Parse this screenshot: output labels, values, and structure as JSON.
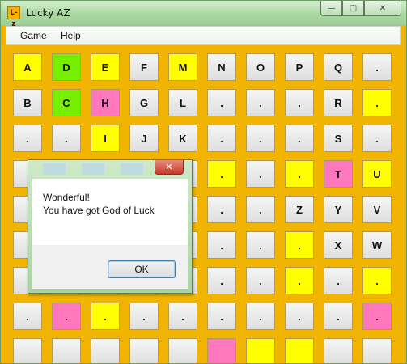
{
  "window": {
    "title": "Lucky AZ",
    "icon": "lucky-az-app-icon",
    "icon_text": "L-z",
    "controls": {
      "minimize": "minimize-icon",
      "maximize": "maximize-icon",
      "close": "close-icon"
    }
  },
  "menu": [
    {
      "label": "Game"
    },
    {
      "label": "Help"
    }
  ],
  "colors": {
    "board": "#f1b400",
    "yellow": "#ffff00",
    "green": "#77ef00",
    "pink": "#ff78bd",
    "gray": "#e6e6e6"
  },
  "board": {
    "rows": [
      [
        {
          "t": "A",
          "c": "yellow"
        },
        {
          "t": "D",
          "c": "green"
        },
        {
          "t": "E",
          "c": "yellow"
        },
        {
          "t": "F",
          "c": "gray"
        },
        {
          "t": "M",
          "c": "yellow"
        },
        {
          "t": "N",
          "c": "gray"
        },
        {
          "t": "O",
          "c": "gray"
        },
        {
          "t": "P",
          "c": "gray"
        },
        {
          "t": "Q",
          "c": "gray"
        },
        {
          "t": ".",
          "c": "gray"
        }
      ],
      [
        {
          "t": "B",
          "c": "gray"
        },
        {
          "t": "C",
          "c": "green"
        },
        {
          "t": "H",
          "c": "pink"
        },
        {
          "t": "G",
          "c": "gray"
        },
        {
          "t": "L",
          "c": "gray"
        },
        {
          "t": ".",
          "c": "gray"
        },
        {
          "t": ".",
          "c": "gray"
        },
        {
          "t": ".",
          "c": "gray"
        },
        {
          "t": "R",
          "c": "gray"
        },
        {
          "t": ".",
          "c": "yellow"
        }
      ],
      [
        {
          "t": ".",
          "c": "gray"
        },
        {
          "t": ".",
          "c": "gray"
        },
        {
          "t": "I",
          "c": "yellow"
        },
        {
          "t": "J",
          "c": "gray"
        },
        {
          "t": "K",
          "c": "gray"
        },
        {
          "t": ".",
          "c": "gray"
        },
        {
          "t": ".",
          "c": "gray"
        },
        {
          "t": ".",
          "c": "gray"
        },
        {
          "t": "S",
          "c": "gray"
        },
        {
          "t": ".",
          "c": "gray"
        }
      ],
      [
        {
          "t": "",
          "c": "gray"
        },
        {
          "t": "",
          "c": "gray"
        },
        {
          "t": "",
          "c": "gray"
        },
        {
          "t": "",
          "c": "gray"
        },
        {
          "t": "",
          "c": "gray"
        },
        {
          "t": ".",
          "c": "yellow"
        },
        {
          "t": ".",
          "c": "gray"
        },
        {
          "t": ".",
          "c": "yellow"
        },
        {
          "t": "T",
          "c": "pink"
        },
        {
          "t": "U",
          "c": "yellow"
        }
      ],
      [
        {
          "t": "",
          "c": "gray"
        },
        {
          "t": "",
          "c": "gray"
        },
        {
          "t": "",
          "c": "gray"
        },
        {
          "t": "",
          "c": "gray"
        },
        {
          "t": "",
          "c": "gray"
        },
        {
          "t": ".",
          "c": "gray"
        },
        {
          "t": ".",
          "c": "gray"
        },
        {
          "t": "Z",
          "c": "gray"
        },
        {
          "t": "Y",
          "c": "gray"
        },
        {
          "t": "V",
          "c": "gray"
        }
      ],
      [
        {
          "t": "",
          "c": "gray"
        },
        {
          "t": "",
          "c": "gray"
        },
        {
          "t": "",
          "c": "gray"
        },
        {
          "t": "",
          "c": "gray"
        },
        {
          "t": "",
          "c": "gray"
        },
        {
          "t": ".",
          "c": "gray"
        },
        {
          "t": ".",
          "c": "gray"
        },
        {
          "t": ".",
          "c": "yellow"
        },
        {
          "t": "X",
          "c": "gray"
        },
        {
          "t": "W",
          "c": "gray"
        }
      ],
      [
        {
          "t": "",
          "c": "gray"
        },
        {
          "t": "",
          "c": "gray"
        },
        {
          "t": "",
          "c": "gray"
        },
        {
          "t": "",
          "c": "gray"
        },
        {
          "t": "",
          "c": "gray"
        },
        {
          "t": ".",
          "c": "gray"
        },
        {
          "t": ".",
          "c": "gray"
        },
        {
          "t": ".",
          "c": "yellow"
        },
        {
          "t": ".",
          "c": "gray"
        },
        {
          "t": ".",
          "c": "yellow"
        }
      ],
      [
        {
          "t": ".",
          "c": "gray"
        },
        {
          "t": ".",
          "c": "pink"
        },
        {
          "t": ".",
          "c": "yellow"
        },
        {
          "t": ".",
          "c": "gray"
        },
        {
          "t": ".",
          "c": "gray"
        },
        {
          "t": ".",
          "c": "gray"
        },
        {
          "t": ".",
          "c": "gray"
        },
        {
          "t": ".",
          "c": "gray"
        },
        {
          "t": ".",
          "c": "gray"
        },
        {
          "t": ".",
          "c": "pink"
        }
      ],
      [
        {
          "t": "",
          "c": "gray"
        },
        {
          "t": "",
          "c": "gray"
        },
        {
          "t": "",
          "c": "gray"
        },
        {
          "t": "",
          "c": "gray"
        },
        {
          "t": "",
          "c": "gray"
        },
        {
          "t": "",
          "c": "pink"
        },
        {
          "t": "",
          "c": "yellow"
        },
        {
          "t": "",
          "c": "yellow"
        },
        {
          "t": "",
          "c": "gray"
        },
        {
          "t": "",
          "c": "gray"
        }
      ]
    ]
  },
  "dialog": {
    "close_icon": "close-icon",
    "message_line1": "Wonderful!",
    "message_line2": "You have got God of Luck",
    "ok_label": "OK"
  }
}
